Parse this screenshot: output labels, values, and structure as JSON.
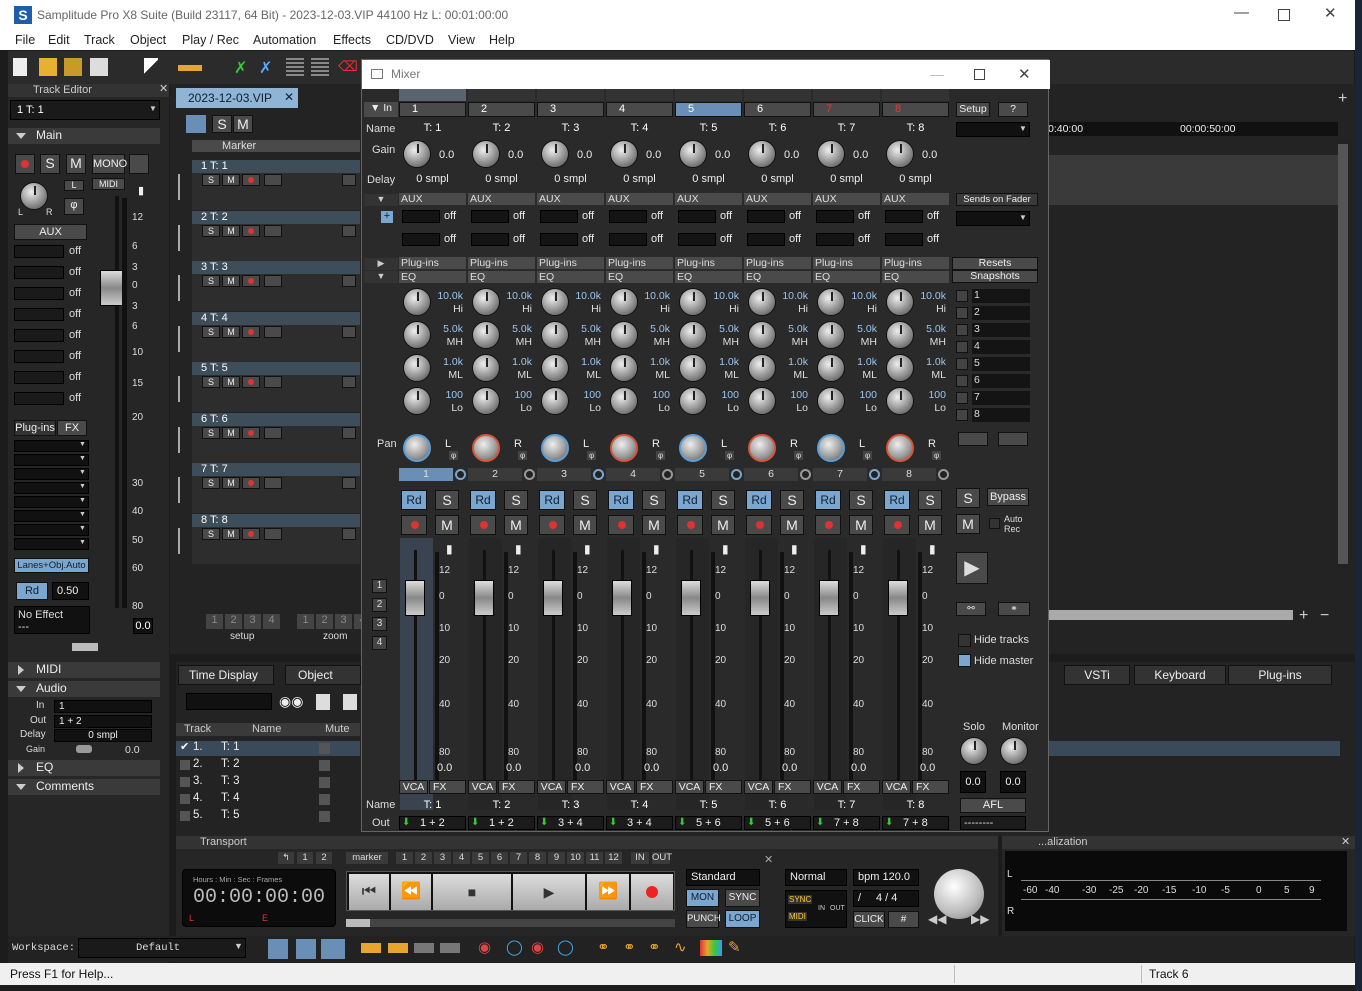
{
  "app": {
    "title": "Samplitude Pro X8 Suite (Build 23117, 64 Bit)  -  2023-12-03.VIP   44100 Hz L: 00:01:00:00",
    "logo": "S"
  },
  "menu": [
    "File",
    "Edit",
    "Track",
    "Object",
    "Play / Rec",
    "Automation",
    "Effects",
    "CD/DVD",
    "View",
    "Help"
  ],
  "track_editor": {
    "title": "Track Editor",
    "track_select": "1  T: 1",
    "main_label": "Main",
    "mono": "MONO",
    "midi": "MIDI",
    "aux_label": "AUX",
    "aux_values": [
      "off",
      "off",
      "off",
      "off",
      "off",
      "off",
      "off",
      "off"
    ],
    "plugins_label": "Plug-ins",
    "fx_label": "FX",
    "lanes_btn": "Lanes+Obj.Auto",
    "rd": "Rd",
    "rd_value": "0.50",
    "no_effect": "No Effect",
    "no_effect_sub": "---",
    "fader_value": "0.0",
    "scale": [
      "12",
      "6",
      "3",
      "0",
      "3",
      "6",
      "10",
      "15",
      "20",
      "30",
      "40",
      "50",
      "60",
      "80"
    ],
    "sections": {
      "midi": "MIDI",
      "audio": "Audio",
      "eq": "EQ",
      "comments": "Comments"
    },
    "audio": {
      "in_label": "In",
      "in_value": "1",
      "out_label": "Out",
      "out_value": "1 + 2",
      "delay_label": "Delay",
      "delay_value": "0 smpl",
      "gain_label": "Gain",
      "gain_value": "0.0"
    }
  },
  "project": {
    "tab": "2023-12-03.VIP",
    "marker": "Marker",
    "tracks": [
      {
        "num": "1",
        "name": "T: 1"
      },
      {
        "num": "2",
        "name": "T: 2"
      },
      {
        "num": "3",
        "name": "T: 3"
      },
      {
        "num": "4",
        "name": "T: 4"
      },
      {
        "num": "5",
        "name": "T: 5"
      },
      {
        "num": "6",
        "name": "T: 6"
      },
      {
        "num": "7",
        "name": "T: 7"
      },
      {
        "num": "8",
        "name": "T: 8"
      }
    ],
    "setup": "setup",
    "zoom": "zoom",
    "nums": [
      "1",
      "2",
      "3",
      "4"
    ],
    "time1": "0:40:00",
    "time2": "00:00:50:00"
  },
  "lower": {
    "tabs": [
      "Time Display",
      "Object Edito"
    ],
    "right_tabs": [
      "VSTi",
      "Keyboard",
      "Plug-ins"
    ],
    "cols": [
      "Track",
      "Name",
      "Mute"
    ],
    "rows": [
      {
        "n": "1.",
        "name": "T: 1"
      },
      {
        "n": "2.",
        "name": "T: 2"
      },
      {
        "n": "3.",
        "name": "T: 3"
      },
      {
        "n": "4.",
        "name": "T: 4"
      },
      {
        "n": "5.",
        "name": "T: 5"
      }
    ]
  },
  "mixer": {
    "title": "Mixer",
    "in_label": "In",
    "name_label": "Name",
    "gain_label": "Gain",
    "delay_label": "Delay",
    "pan_label": "Pan",
    "out_label": "Out",
    "aux": "AUX",
    "plugins": "Plug-ins",
    "eq": "EQ",
    "setup": "Setup",
    "help": "?",
    "sends_on_fader": "Sends on Fader",
    "resets": "Resets",
    "snapshots": "Snapshots",
    "snapshot_nums": [
      "1",
      "2",
      "3",
      "4",
      "5",
      "6",
      "7",
      "8"
    ],
    "bypass": "Bypass",
    "auto_rec": "Auto Rec",
    "hide_tracks": "Hide tracks",
    "hide_master": "Hide master",
    "solo": "Solo",
    "monitor": "Monitor",
    "solo_val": "0.0",
    "monitor_val": "0.0",
    "afl": "AFL",
    "master_out": "--------",
    "group_nums": [
      "1",
      "2",
      "3",
      "4"
    ],
    "vca": "VCA",
    "fx": "FX",
    "rd": "Rd",
    "s": "S",
    "m": "M",
    "scale": [
      "12",
      "0",
      "10",
      "20",
      "40",
      "80"
    ],
    "channels": [
      {
        "num": "1",
        "name": "T: 1",
        "gain": "0.0",
        "delay": "0 smpl",
        "off": "off",
        "hi": "10.0k",
        "mh": "5.0k",
        "ml": "1.0k",
        "lo": "100",
        "pan": "L",
        "fader": "0.0",
        "out": "1 + 2",
        "pan_color": "#5a9fd8"
      },
      {
        "num": "2",
        "name": "T: 2",
        "gain": "0.0",
        "delay": "0 smpl",
        "off": "off",
        "hi": "10.0k",
        "mh": "5.0k",
        "ml": "1.0k",
        "lo": "100",
        "pan": "R",
        "fader": "0.0",
        "out": "1 + 2",
        "pan_color": "#d8553a"
      },
      {
        "num": "3",
        "name": "T: 3",
        "gain": "0.0",
        "delay": "0 smpl",
        "off": "off",
        "hi": "10.0k",
        "mh": "5.0k",
        "ml": "1.0k",
        "lo": "100",
        "pan": "L",
        "fader": "0.0",
        "out": "3 + 4",
        "pan_color": "#5a9fd8"
      },
      {
        "num": "4",
        "name": "T: 4",
        "gain": "0.0",
        "delay": "0 smpl",
        "off": "off",
        "hi": "10.0k",
        "mh": "5.0k",
        "ml": "1.0k",
        "lo": "100",
        "pan": "R",
        "fader": "0.0",
        "out": "3 + 4",
        "pan_color": "#d8553a"
      },
      {
        "num": "5",
        "name": "T: 5",
        "gain": "0.0",
        "delay": "0 smpl",
        "off": "off",
        "hi": "10.0k",
        "mh": "5.0k",
        "ml": "1.0k",
        "lo": "100",
        "pan": "L",
        "fader": "0.0",
        "out": "5 + 6",
        "pan_color": "#5a9fd8"
      },
      {
        "num": "6",
        "name": "T: 6",
        "gain": "0.0",
        "delay": "0 smpl",
        "off": "off",
        "hi": "10.0k",
        "mh": "5.0k",
        "ml": "1.0k",
        "lo": "100",
        "pan": "R",
        "fader": "0.0",
        "out": "5 + 6",
        "pan_color": "#d8553a"
      },
      {
        "num": "7",
        "name": "T: 7",
        "gain": "0.0",
        "delay": "0 smpl",
        "off": "off",
        "hi": "10.0k",
        "mh": "5.0k",
        "ml": "1.0k",
        "lo": "100",
        "pan": "L",
        "fader": "0.0",
        "out": "7 + 8",
        "pan_color": "#5a9fd8"
      },
      {
        "num": "8",
        "name": "T: 8",
        "gain": "0.0",
        "delay": "0 smpl",
        "off": "off",
        "hi": "10.0k",
        "mh": "5.0k",
        "ml": "1.0k",
        "lo": "100",
        "pan": "R",
        "fader": "0.0",
        "out": "7 + 8",
        "pan_color": "#d8553a"
      }
    ],
    "band_labels": {
      "hi": "Hi",
      "mh": "MH",
      "ml": "ML",
      "lo": "Lo"
    }
  },
  "transport": {
    "title": "Transport",
    "nums": [
      "1",
      "2"
    ],
    "marker": "marker",
    "marker_nums": [
      "1",
      "2",
      "3",
      "4",
      "5",
      "6",
      "7",
      "8",
      "9",
      "10",
      "11",
      "12"
    ],
    "in": "IN",
    "out": "OUT",
    "time_hdr": "Hours : Min : Sec : Frames",
    "time": "00:00:00:00",
    "l": "L",
    "e": "E",
    "mode": "Standard",
    "mon": "MON",
    "sync": "SYNC",
    "punch": "PUNCH",
    "loop": "LOOP",
    "normal": "Normal",
    "bpm": "bpm  120.0",
    "sig": "4 / 4",
    "slash": "/",
    "click": "CLICK",
    "sync_small": "SYNC",
    "midi_small": "MIDI",
    "in_small": "IN",
    "out_small": "OUT",
    "hash": "#"
  },
  "visualization": {
    "title": "...alization",
    "scale": [
      "-60",
      "-40",
      "-30",
      "-25",
      "-20",
      "-15",
      "-10",
      "-5",
      "0",
      "5",
      "9"
    ],
    "l": "L",
    "r": "R"
  },
  "workspace": {
    "label": "Workspace:",
    "value": "Default"
  },
  "status": {
    "left": "Press F1 for Help...",
    "right": "Track 6"
  },
  "colors": {
    "accent": "#7aa6cf",
    "record": "#d33",
    "track_header": "#3d4d5a",
    "project_tab": "#8fb4d6"
  }
}
